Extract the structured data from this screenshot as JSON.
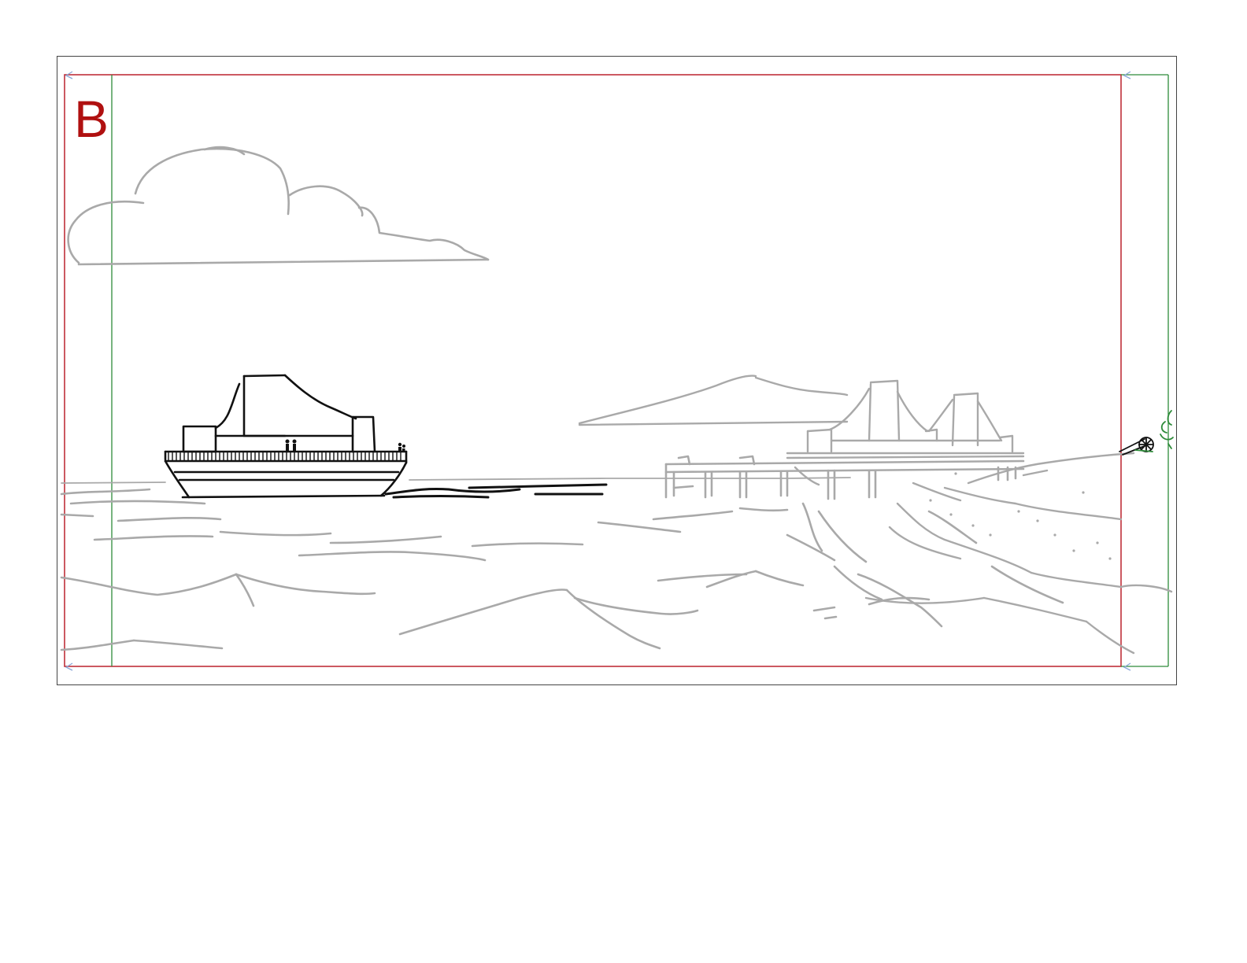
{
  "panel": {
    "letter": "B"
  },
  "colors": {
    "panel_letter": "#b01010",
    "action_safe_frame": "#c0303a",
    "title_safe_frame": "#2e8b3a",
    "rough_sketch": "#a9a9a9",
    "ink_sketch": "#111111",
    "panel_border": "#444444"
  },
  "icons": {
    "boat": "ferry-boat-icon",
    "dock": "pier-icon",
    "cannon": "cannon-icon"
  }
}
